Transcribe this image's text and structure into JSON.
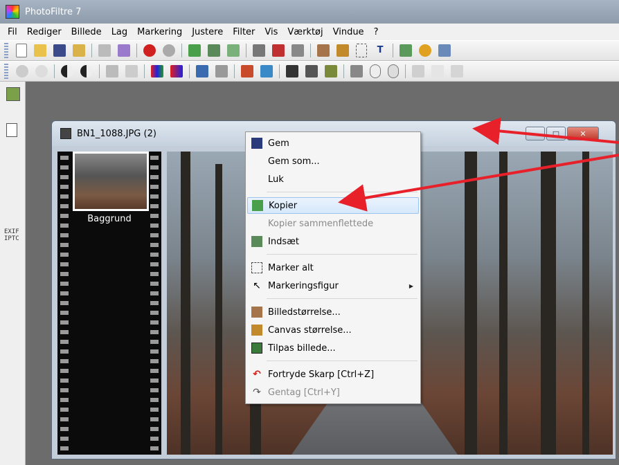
{
  "app": {
    "title": "PhotoFiltre 7"
  },
  "menu": [
    "Fil",
    "Rediger",
    "Billede",
    "Lag",
    "Markering",
    "Justere",
    "Filter",
    "Vis",
    "Værktøj",
    "Vindue",
    "?"
  ],
  "sidebar": {
    "exif_label": "EXIF\nIPTC"
  },
  "document": {
    "title": "BN1_1088.JPG (2)",
    "layer_label": "Baggrund",
    "buttons": {
      "minimize": "—",
      "maximize": "□",
      "close": "✕"
    }
  },
  "context_menu": {
    "items": [
      {
        "label": "Gem",
        "icon": "save-icon"
      },
      {
        "label": "Gem som...",
        "icon": ""
      },
      {
        "label": "Luk",
        "icon": ""
      },
      {
        "label": "Kopier",
        "icon": "copy-icon",
        "highlighted": true
      },
      {
        "label": "Kopier sammenflettede",
        "icon": "",
        "disabled": true
      },
      {
        "label": "Indsæt",
        "icon": "paste-icon"
      },
      {
        "label": "Marker alt",
        "icon": "select-all-icon"
      },
      {
        "label": "Markeringsfigur",
        "icon": "cursor-icon",
        "submenu": true
      },
      {
        "label": "Billedstørrelse...",
        "icon": "image-size-icon"
      },
      {
        "label": "Canvas størrelse...",
        "icon": "canvas-size-icon"
      },
      {
        "label": "Tilpas billede...",
        "icon": "fit-image-icon"
      },
      {
        "label": "Fortryde Skarp [Ctrl+Z]",
        "icon": "undo-icon"
      },
      {
        "label": "Gentag [Ctrl+Y]",
        "icon": "redo-icon",
        "disabled": true
      }
    ]
  },
  "colors": {
    "highlight": "#d6e8fb",
    "annotation_arrow": "#e8202a"
  }
}
